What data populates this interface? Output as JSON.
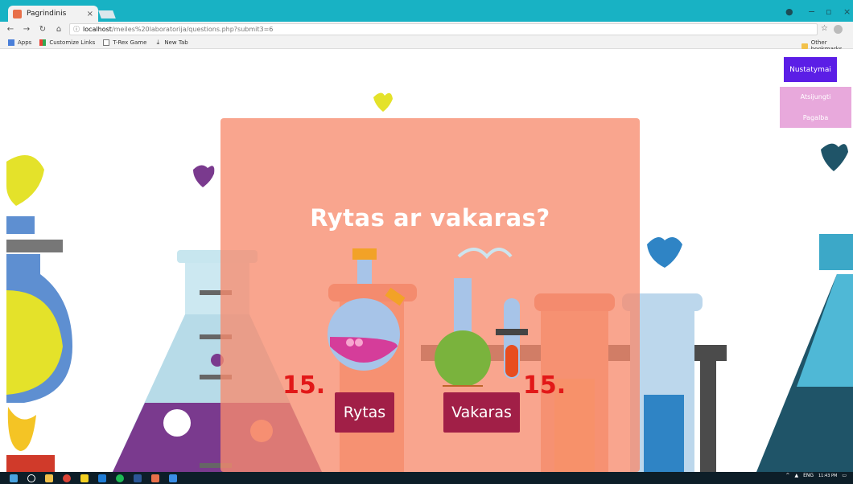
{
  "browser": {
    "tab_title": "Pagrindinis",
    "tab_close": "×",
    "url_host": "localhost",
    "url_path": "/meiles%20laboratorija/questions.php?submit3=6",
    "bookmarks": [
      "Apps",
      "Customize Links",
      "T-Rex Game",
      "New Tab"
    ],
    "other_bookmarks": "Other bookmarks",
    "window_controls": [
      "−",
      "▫",
      "×"
    ]
  },
  "page": {
    "question": "Rytas ar vakaras?",
    "answer_left": "Rytas",
    "answer_right": "Vakaras",
    "count_left": "15.",
    "count_right": "15."
  },
  "menu": {
    "settings": "Nustatymai",
    "logout": "Atsijungti",
    "help": "Pagalba"
  },
  "taskbar": {
    "lang": "ENG",
    "time": "11:43 PM"
  },
  "colors": {
    "tab_strip": "#18b2c4",
    "panel": "#f78c6e",
    "answer_button": "#a11f47",
    "count_text": "#e21818",
    "settings_button": "#5b1ee6",
    "menu_box": "#e8a9dc"
  }
}
